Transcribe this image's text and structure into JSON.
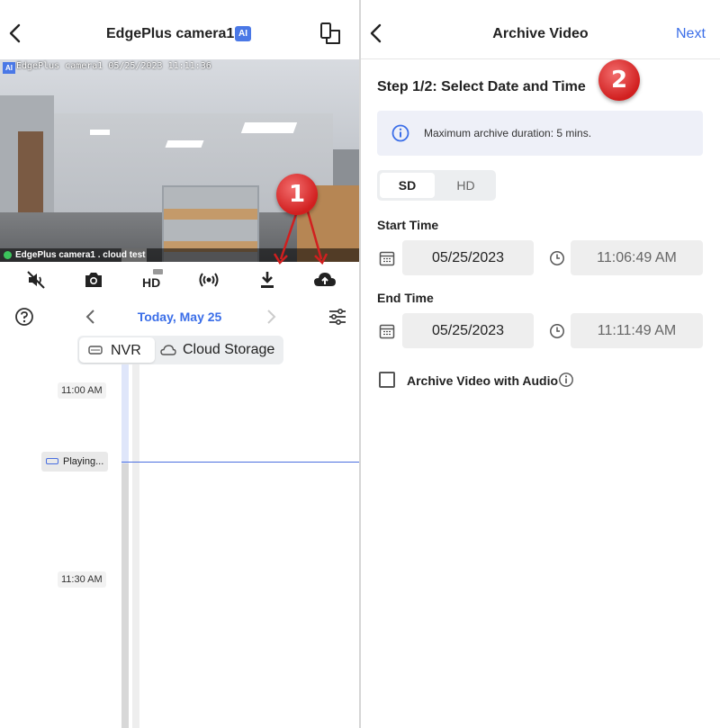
{
  "left": {
    "header": {
      "title": "EdgePlus camera1",
      "ai_badge": "AI"
    },
    "video": {
      "osd_ai": "AI",
      "osd_text": "EdgePlus camera1 05/25/2023 11:11:36",
      "caption": "EdgePlus camera1 . cloud test"
    },
    "toolbar": {
      "icons": [
        "mute-icon",
        "camera-icon",
        "hd-icon",
        "ptz-icon",
        "download-icon",
        "cloud-upload-icon"
      ],
      "hd_label": "HD"
    },
    "date_nav": {
      "date_label": "Today, May 25"
    },
    "source_tabs": [
      {
        "label": "NVR",
        "selected": true
      },
      {
        "label": "Cloud Storage",
        "selected": false
      }
    ],
    "timeline": {
      "labels": [
        "11:00 AM",
        "11:30 AM"
      ],
      "playing_label": "Playing..."
    }
  },
  "markers": [
    "1",
    "2"
  ],
  "right": {
    "header": {
      "title": "Archive Video",
      "next_label": "Next"
    },
    "step_label": "Step 1/2: Select Date and Time",
    "info_text": "Maximum archive duration: 5 mins.",
    "quality": {
      "options": [
        "SD",
        "HD"
      ],
      "selected": "SD"
    },
    "start": {
      "label": "Start Time",
      "date": "05/25/2023",
      "time": "11:06:49 AM"
    },
    "end": {
      "label": "End Time",
      "date": "05/25/2023",
      "time": "11:11:49 AM"
    },
    "audio_option": {
      "label": "Archive Video with Audio",
      "checked": false
    }
  },
  "colors": {
    "accent": "#3b6ee8",
    "marker": "#d11f1f",
    "live_dot": "#3cc35c"
  }
}
